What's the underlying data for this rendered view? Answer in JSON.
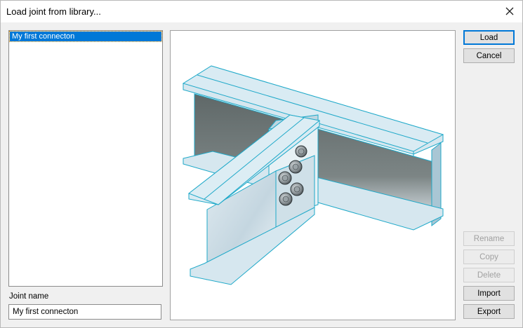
{
  "window": {
    "title": "Load joint from library..."
  },
  "library": {
    "items": [
      "My first connecton"
    ],
    "selected_index": 0
  },
  "joint_name": {
    "label": "Joint name",
    "value": "My first connecton"
  },
  "buttons": {
    "load": "Load",
    "cancel": "Cancel",
    "rename": "Rename",
    "copy": "Copy",
    "delete": "Delete",
    "import": "Import",
    "export": "Export"
  },
  "icons": {
    "close": "close-icon"
  },
  "colors": {
    "selection": "#0078d7",
    "steel_face": "#cfe3ee",
    "steel_edge": "#1fa9c9",
    "web_shadow": "#6f7777"
  }
}
